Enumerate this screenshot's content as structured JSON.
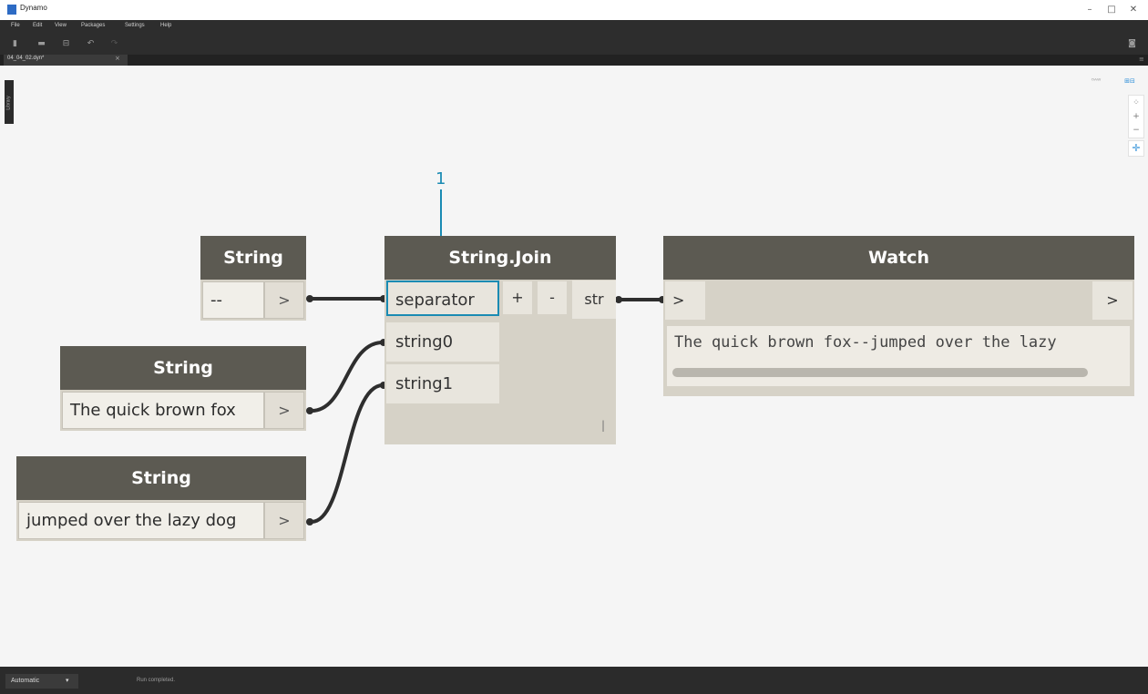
{
  "window": {
    "title": "Dynamo",
    "minimize": "–",
    "maximize": "□",
    "close": "✕"
  },
  "menu": [
    "File",
    "Edit",
    "View",
    "Packages",
    "Settings",
    "Help"
  ],
  "toolbar": {
    "icons": [
      "new-file-icon",
      "open-file-icon",
      "save-icon",
      "undo-icon",
      "redo-icon"
    ],
    "camera_icon": "camera-icon"
  },
  "tab": {
    "name": "04_04_02.dyn*",
    "close": "×"
  },
  "library": {
    "label": "Library"
  },
  "nodes": {
    "string_sep": {
      "title": "String",
      "value": "--",
      "out": ">"
    },
    "string_a": {
      "title": "String",
      "value": "The quick brown fox",
      "out": ">"
    },
    "string_b": {
      "title": "String",
      "value": "jumped over the lazy dog",
      "out": ">"
    },
    "join": {
      "title": "String.Join",
      "inputs": [
        "separator",
        "string0",
        "string1"
      ],
      "add": "+",
      "remove": "-",
      "output": "str",
      "lacing": "|"
    },
    "watch": {
      "title": "Watch",
      "in": ">",
      "out": ">",
      "result": "The quick brown fox--jumped over the lazy"
    }
  },
  "annotation": {
    "label": "1"
  },
  "status": {
    "run_mode": "Automatic",
    "dropdown": "▾",
    "message": "Run completed."
  },
  "colors": {
    "header": "#5c5a52",
    "body": "#d6d2c7",
    "highlight": "#1a8bb3",
    "wire": "#2e2e2e"
  }
}
